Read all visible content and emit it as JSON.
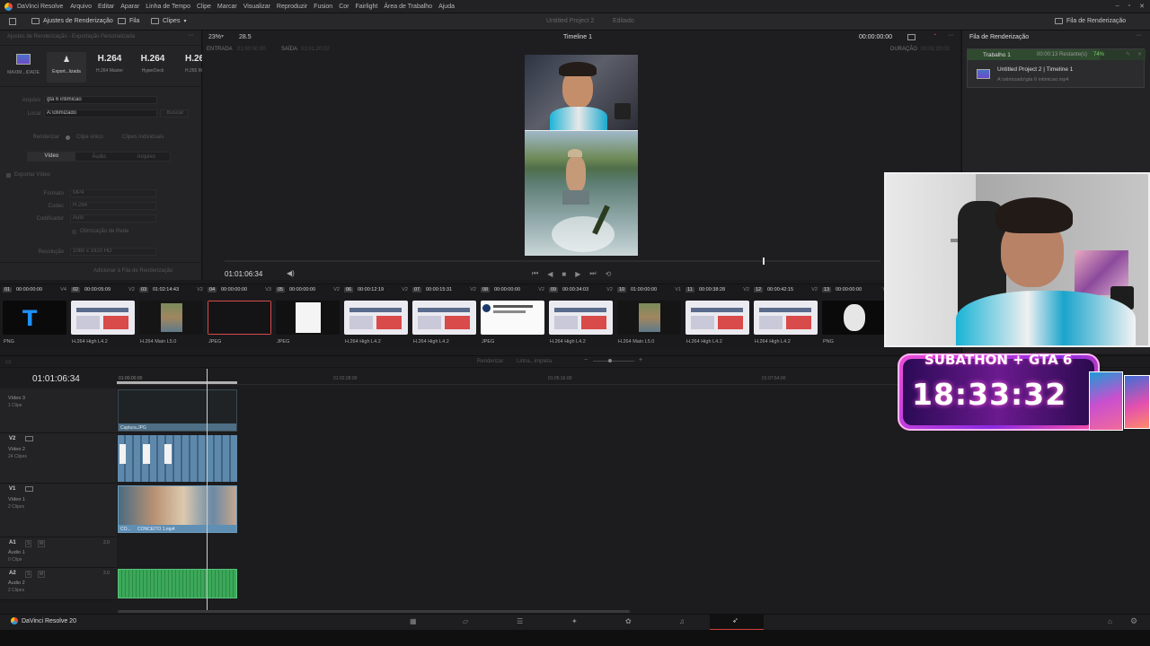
{
  "menubar": {
    "app_name": "DaVinci Resolve",
    "items": [
      "Arquivo",
      "Editar",
      "Aparar",
      "Linha de Tempo",
      "Clipe",
      "Marcar",
      "Visualizar",
      "Reproduzir",
      "Fusion",
      "Cor",
      "Fairlight",
      "Área de Trabalho",
      "Ajuda"
    ]
  },
  "toolbar": {
    "render_settings": "Ajustes de Renderização",
    "queue_toggle": "Fila",
    "clips_toggle": "Clipes",
    "project_title": "Untitled Project 2",
    "project_status": "Editado",
    "render_queue_btn": "Fila de Renderização"
  },
  "render_settings": {
    "header": "Ajustes de Renderização - Exportação Personalizada",
    "presets": [
      {
        "label": "MAXIM...IDADE",
        "title": "",
        "icon": "monitor-icon"
      },
      {
        "label": "Export...lizada",
        "title": "",
        "icon": "custom-export-icon"
      },
      {
        "label": "H.264 Master",
        "title": "H.264",
        "icon": ""
      },
      {
        "label": "HyperDeck",
        "title": "H.264",
        "icon": ""
      },
      {
        "label": "H.265 M",
        "title": "H.26",
        "icon": ""
      }
    ],
    "filename_label": "Arquivo",
    "filename_value": "gta 6 intimicao",
    "location_label": "Local",
    "location_value": "A:\\otimizado",
    "browse_btn": "Buscar",
    "render_label": "Renderizar",
    "single_clip": "Clipe único",
    "individual_clips": "Clipes individuais",
    "tabs": [
      "Vídeo",
      "Áudio",
      "Arquivo"
    ],
    "export_video": "Exportar Vídeo",
    "format_label": "Formato",
    "format_value": "MP4",
    "codec_label": "Codec",
    "codec_value": "H.264",
    "encoder_label": "Codificador",
    "encoder_value": "Auto",
    "network_opt": "Otimização de Rede",
    "resolution_label": "Resolução",
    "resolution_value": "1080 x 1920 HD",
    "add_queue_btn": "Adicionar à Fila de Renderização"
  },
  "viewer": {
    "zoom": "23%",
    "fps": "28.5",
    "timeline_name": "Timeline 1",
    "timecode_right": "00:00:00:00",
    "in_label": "ENTRADA",
    "in_value": "01:00:00:00",
    "out_label": "SAÍDA",
    "out_value": "01:01:20:02",
    "duration_label": "DURAÇÃO",
    "duration_value": "00:01:20:03",
    "current_tc": "01:01:06:34",
    "scrub_progress": 0.82
  },
  "render_queue": {
    "title": "Fila de Renderização",
    "job_name": "Trabalho 1",
    "job_remaining": "00:00:13 Restante(s)",
    "job_percent": "74%",
    "job_title": "Untitled Project 2 | Timeline 1",
    "job_path": "A:\\otimizado\\gta 6 intimicao.mp4",
    "progress": 0.74
  },
  "clips": [
    {
      "num": "01",
      "tc": "00:00:00:00",
      "track": "V4",
      "codec": "PNG",
      "kind": "t"
    },
    {
      "num": "02",
      "tc": "00:00:05:09",
      "track": "V2",
      "codec": "H.264 High L4.2",
      "kind": "web"
    },
    {
      "num": "03",
      "tc": "01:02:14:43",
      "track": "V2",
      "codec": "H.264 Main L5.0",
      "kind": "video"
    },
    {
      "num": "04",
      "tc": "00:00:00:00",
      "track": "V3",
      "codec": "JPEG",
      "kind": "dark"
    },
    {
      "num": "05",
      "tc": "00:00:00:00",
      "track": "V2",
      "codec": "JPEG",
      "kind": "doc"
    },
    {
      "num": "06",
      "tc": "00:00:12:19",
      "track": "V2",
      "codec": "H.264 High L4.2",
      "kind": "web"
    },
    {
      "num": "07",
      "tc": "00:00:15:31",
      "track": "V2",
      "codec": "H.264 High L4.2",
      "kind": "web"
    },
    {
      "num": "08",
      "tc": "00:00:00:00",
      "track": "V2",
      "codec": "JPEG",
      "kind": "tweet"
    },
    {
      "num": "09",
      "tc": "00:00:34:03",
      "track": "V2",
      "codec": "H.264 High L4.2",
      "kind": "web"
    },
    {
      "num": "10",
      "tc": "01:00:00:00",
      "track": "V1",
      "codec": "H.264 Main L5.0",
      "kind": "video"
    },
    {
      "num": "11",
      "tc": "00:00:38:28",
      "track": "V2",
      "codec": "H.264 High L4.2",
      "kind": "web"
    },
    {
      "num": "12",
      "tc": "00:00:42:15",
      "track": "V2",
      "codec": "H.264 High L4.2",
      "kind": "web"
    },
    {
      "num": "13",
      "tc": "00:00:00:00",
      "track": "V",
      "codec": "PNG",
      "kind": "meme"
    }
  ],
  "timeline": {
    "timecode": "01:01:06:34",
    "ruler": [
      "01:00:00:00",
      "01:02:28:00",
      "01:05:16:00",
      "01:07:54:00"
    ],
    "mode_label": "Renderizar",
    "mode_value": "Linha...impleta",
    "tracks": [
      {
        "id": "",
        "name": "Vídeo 3",
        "count": "1 Clipe"
      },
      {
        "id": "V2",
        "name": "Vídeo 2",
        "count": "24 Clipes"
      },
      {
        "id": "V1",
        "name": "Vídeo 1",
        "count": "2 Clipes"
      },
      {
        "id": "A1",
        "name": "Áudio 1",
        "count": "0 Clipe",
        "level": "2.0"
      },
      {
        "id": "A2",
        "name": "Áudio 2",
        "count": "2 Clipes",
        "level": "2.0"
      }
    ],
    "clip_v3_name": "Captura.JPG",
    "clip_v1_a": "CO...",
    "clip_v1_b": "CONCEITO 1.mp4"
  },
  "overlay": {
    "title": "SUBATHON + GTA 6",
    "timer": "18:33:32"
  },
  "bottombar": {
    "app_name": "DaVinci Resolve 20"
  }
}
